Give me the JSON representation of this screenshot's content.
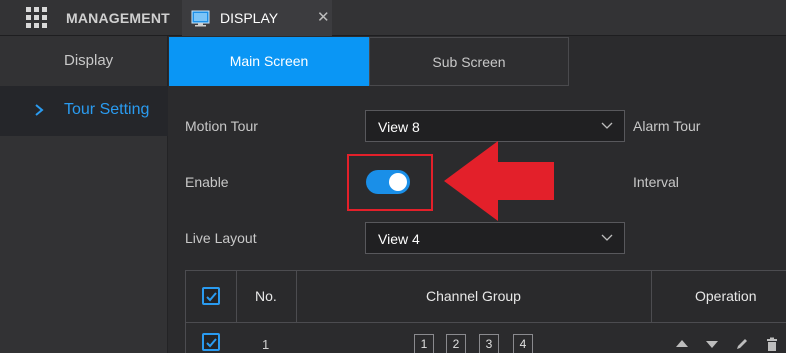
{
  "topbar": {
    "management_label": "MANAGEMENT",
    "active_tab_label": "DISPLAY",
    "close_symbol": "✕",
    "icons": [
      "grid-menu-icon",
      "monitor-icon",
      "close-icon"
    ]
  },
  "sidebar": {
    "items": [
      {
        "label": "Display",
        "active": false
      },
      {
        "label": "Tour Setting",
        "active": true
      }
    ]
  },
  "subtabs": [
    {
      "label": "Main Screen",
      "active": true
    },
    {
      "label": "Sub Screen",
      "active": false
    }
  ],
  "form": {
    "motion_tour_label": "Motion Tour",
    "motion_tour_value": "View 8",
    "alarm_tour_label": "Alarm Tour",
    "enable_label": "Enable",
    "enable_on": true,
    "interval_label": "Interval",
    "live_layout_label": "Live Layout",
    "live_layout_value": "View 4"
  },
  "table": {
    "headers": {
      "no": "No.",
      "channel_group": "Channel Group",
      "operation": "Operation"
    },
    "rows": [
      {
        "checked": true,
        "no": "1",
        "channels": [
          "1",
          "2",
          "3",
          "4"
        ]
      }
    ]
  },
  "colors": {
    "accent": "#0a96f5",
    "highlight_red": "#e3202a",
    "background": "#2b2b2d"
  }
}
